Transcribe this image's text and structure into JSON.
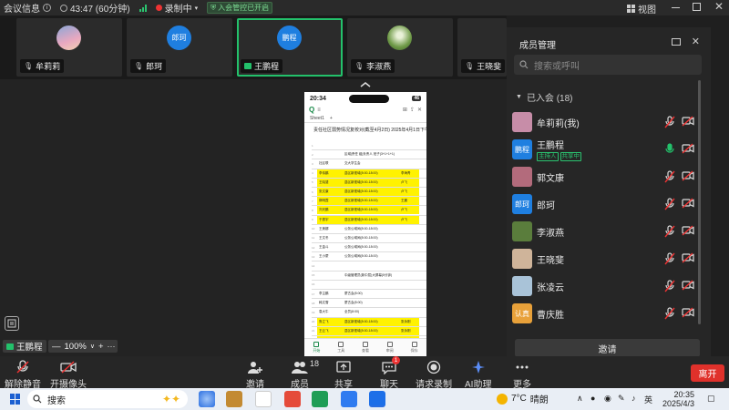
{
  "topbar": {
    "meeting_info": "会议信息",
    "timer": "43:47 (60分钟)",
    "recording": "录制中",
    "security_badge": "入会管控已开启",
    "view": "视图"
  },
  "participants_strip": [
    {
      "name": "牟莉莉",
      "avatar_text": "",
      "avatar_color": "#c78da8",
      "active": false
    },
    {
      "name": "郎珂",
      "avatar_text": "郎珂",
      "avatar_color": "#1f7fe0",
      "active": false
    },
    {
      "name": "王鹏程",
      "avatar_text": "鹏程",
      "avatar_color": "#1f7fe0",
      "active": true
    },
    {
      "name": "李淑燕",
      "avatar_text": "",
      "avatar_color": "#5a7d3c",
      "active": false
    },
    {
      "name": "王晓斐",
      "avatar_text": "",
      "avatar_color": "#cfb49a",
      "active": false
    }
  ],
  "phone": {
    "time": "20:34",
    "battery": "46",
    "sheet_tab": "Sheet1",
    "title": "责任社区弱势情况复校对(截至4月2日)  2025年4月1日下午2点",
    "header_row": "区域（责任）组（负责人）班子(3+1+1+1)",
    "rows": [
      {
        "n": "1",
        "c1": "",
        "c2": "",
        "c3": "",
        "hl": false
      },
      {
        "n": "2",
        "c1": "",
        "c2": "区域|责任 组|负责人 班子(3+1+1+1)",
        "c3": "",
        "hl": false
      },
      {
        "n": "3",
        "c1": "社区联",
        "c2": "交大学生会",
        "c3": "",
        "hl": false
      },
      {
        "n": "4",
        "c1": "李伟鹏",
        "c2": "县区新视域(8:00-18:00)",
        "c3": "李海青",
        "hl": true
      },
      {
        "n": "5",
        "c1": "王晓斐",
        "c2": "县区新视域(8:00-18:00)",
        "c3": "卢飞",
        "hl": true
      },
      {
        "n": "6",
        "c1": "张文康",
        "c2": "县区新视域(8:00-18:00)",
        "c3": "卢飞",
        "hl": true
      },
      {
        "n": "7",
        "c1": "郭明霞",
        "c2": "县区新视域(8:00-18:00)",
        "c3": "王震",
        "hl": true
      },
      {
        "n": "8",
        "c1": "刘天鹏",
        "c2": "县区新视域(8:00-18:00)",
        "c3": "卢飞",
        "hl": true
      },
      {
        "n": "9",
        "c1": "于振宇",
        "c2": "县区新视域(8:00-18:00)",
        "c3": "卢飞",
        "hl": true
      },
      {
        "n": "10",
        "c1": "王美娜",
        "c2": "公务公域间(8:00-18:00)",
        "c3": "",
        "hl": false
      },
      {
        "n": "11",
        "c1": "王文冬",
        "c2": "公务公域间(8:00-18:00)",
        "c3": "",
        "hl": false
      },
      {
        "n": "12",
        "c1": "王金斗",
        "c2": "公务公域间(8:00-18:00)",
        "c3": "",
        "hl": false
      },
      {
        "n": "13",
        "c1": "王小蒙",
        "c2": "公务公域间(8:00-18:00)",
        "c3": "",
        "hl": false
      },
      {
        "n": "14",
        "c1": "",
        "c2": "",
        "c3": "",
        "hl": false
      },
      {
        "n": "15",
        "c1": "",
        "c2": "中级管理员(新中层)大屏幕(5分钟)",
        "c3": "",
        "hl": false
      },
      {
        "n": "16",
        "c1": "",
        "c2": "",
        "c3": "",
        "hl": false
      },
      {
        "n": "17",
        "c1": "李主鹏",
        "c2": "蒙古会(8:00)",
        "c3": "",
        "hl": false
      },
      {
        "n": "18",
        "c1": "韩文雪",
        "c2": "蒙古会(8:00)",
        "c3": "",
        "hl": false
      },
      {
        "n": "19",
        "c1": "袁大牛",
        "c2": "全员(8:00)",
        "c3": "",
        "hl": false
      },
      {
        "n": "20",
        "c1": "鲁立飞",
        "c2": "县区新视域(8:00-18:00)",
        "c3": "张永刚",
        "hl": true
      },
      {
        "n": "21",
        "c1": "王云飞",
        "c2": "县区新视域(8:00-18:00)",
        "c3": "张永刚",
        "hl": true
      },
      {
        "n": "22",
        "c1": "王云龙",
        "c2": "县区新视域(8:00-18:00)",
        "c3": "张永刚",
        "hl": true
      },
      {
        "n": "23",
        "c1": "杨景鹏",
        "c2": "县区新视域(8:00-18:00)",
        "c3": "张永刚",
        "hl": true
      }
    ],
    "tabs": [
      "开始",
      "工具",
      "查看",
      "审阅",
      "保存"
    ]
  },
  "stage": {
    "speaker_name": "王鹏程",
    "zoom": "100%",
    "zoom_minus": "—",
    "zoom_plus": "+",
    "more": "···"
  },
  "panel": {
    "title": "成员管理",
    "search_placeholder": "搜索或呼叫",
    "joined_label": "已入会 (18)",
    "members": [
      {
        "name": "牟莉莉(我)",
        "avatar_text": "",
        "avatar_color": "#c78da8",
        "tags": [],
        "mic": "muted"
      },
      {
        "name": "王鹏程",
        "avatar_text": "鹏程",
        "avatar_color": "#1f7fe0",
        "tags": [
          "主持人",
          "共享中"
        ],
        "mic": "on"
      },
      {
        "name": "郭文康",
        "avatar_text": "",
        "avatar_color": "#b36b7c",
        "tags": [],
        "mic": "muted"
      },
      {
        "name": "郎珂",
        "avatar_text": "郎珂",
        "avatar_color": "#1f7fe0",
        "tags": [],
        "mic": "muted"
      },
      {
        "name": "李淑燕",
        "avatar_text": "",
        "avatar_color": "#5a7d3c",
        "tags": [],
        "mic": "muted"
      },
      {
        "name": "王晓斐",
        "avatar_text": "",
        "avatar_color": "#cfb49a",
        "tags": [],
        "mic": "muted"
      },
      {
        "name": "张凌云",
        "avatar_text": "",
        "avatar_color": "#a9c3d8",
        "tags": [],
        "mic": "muted"
      },
      {
        "name": "曹庆胜",
        "avatar_text": "认真",
        "avatar_color": "#e8a13a",
        "tags": [],
        "mic": "muted"
      }
    ],
    "invite": "邀请"
  },
  "toolbar": {
    "unmute": "解除静音",
    "camera": "开摄像头",
    "invite": "邀请",
    "members": "成员",
    "members_count": "18",
    "share": "共享",
    "chat": "聊天",
    "chat_badge": "1",
    "request_record": "请求录制",
    "ai": "AI助理",
    "more": "更多",
    "leave": "离开"
  },
  "taskbar": {
    "search": "搜索",
    "weather_temp": "7°C",
    "weather_text": "晴朗",
    "ime": "英",
    "time": "20:35",
    "date": "2025/4/3"
  },
  "colors": {
    "accent_green": "#23c16b",
    "leave_red": "#e0312b",
    "highlight_yellow": "#fff200",
    "host_blue": "#1f7fe0"
  }
}
